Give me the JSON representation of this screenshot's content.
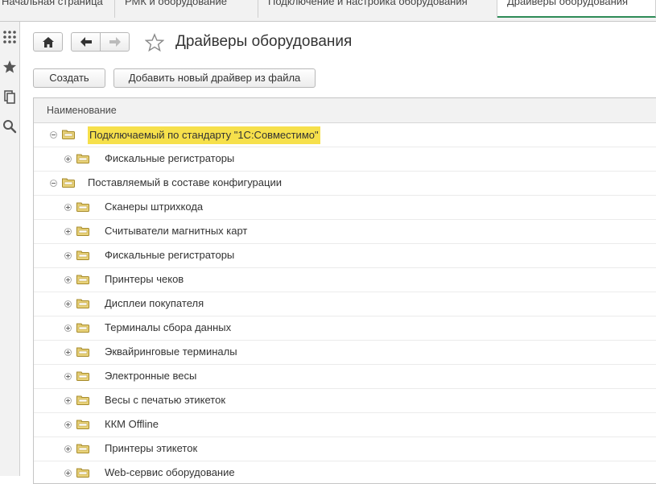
{
  "tabs": [
    {
      "label": "Начальная страница",
      "active": false
    },
    {
      "label": "РМК и оборудование",
      "active": false
    },
    {
      "label": "Подключение и настройка оборудования",
      "active": false
    },
    {
      "label": "Драйверы оборудования",
      "active": true
    }
  ],
  "leftbar": {
    "icons": [
      "apps-grid-icon",
      "favorites-star-icon",
      "history-icon",
      "search-icon"
    ]
  },
  "header": {
    "title": "Драйверы оборудования"
  },
  "toolbar": {
    "create_label": "Создать",
    "add_driver_label": "Добавить новый драйвер из файла"
  },
  "grid": {
    "column_header": "Наименование",
    "rows": [
      {
        "label": "Подключаемый по стандарту \"1С:Совместимо\"",
        "level": 0,
        "expanded": true,
        "selected": true
      },
      {
        "label": "Фискальные регистраторы",
        "level": 1,
        "expanded": false,
        "selected": false
      },
      {
        "label": "Поставляемый в составе конфигурации",
        "level": 0,
        "expanded": true,
        "selected": false
      },
      {
        "label": "Сканеры штрихкода",
        "level": 1,
        "expanded": false,
        "selected": false
      },
      {
        "label": "Считыватели магнитных карт",
        "level": 1,
        "expanded": false,
        "selected": false
      },
      {
        "label": "Фискальные регистраторы",
        "level": 1,
        "expanded": false,
        "selected": false
      },
      {
        "label": "Принтеры чеков",
        "level": 1,
        "expanded": false,
        "selected": false
      },
      {
        "label": "Дисплеи покупателя",
        "level": 1,
        "expanded": false,
        "selected": false
      },
      {
        "label": "Терминалы сбора данных",
        "level": 1,
        "expanded": false,
        "selected": false
      },
      {
        "label": "Эквайринговые терминалы",
        "level": 1,
        "expanded": false,
        "selected": false
      },
      {
        "label": "Электронные весы",
        "level": 1,
        "expanded": false,
        "selected": false
      },
      {
        "label": "Весы с печатью этикеток",
        "level": 1,
        "expanded": false,
        "selected": false
      },
      {
        "label": "ККМ Offline",
        "level": 1,
        "expanded": false,
        "selected": false
      },
      {
        "label": "Принтеры этикеток",
        "level": 1,
        "expanded": false,
        "selected": false
      },
      {
        "label": "Web-сервис оборудование",
        "level": 1,
        "expanded": false,
        "selected": false
      }
    ]
  },
  "colors": {
    "selection_highlight": "#f6e04b",
    "active_tab_underline": "#2e8b57",
    "folder_fill": "#e8d27a"
  }
}
